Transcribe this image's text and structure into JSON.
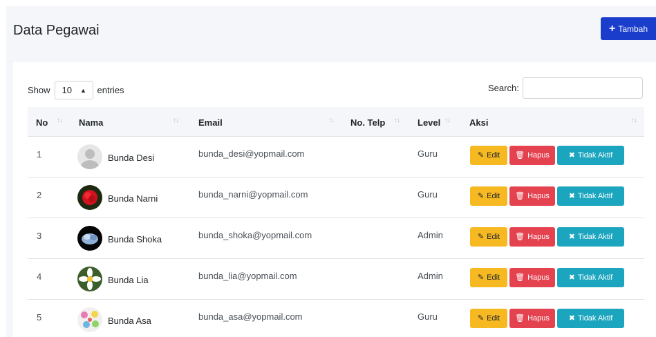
{
  "header": {
    "title": "Data Pegawai",
    "add_label": "Tambah"
  },
  "table_controls": {
    "show_label": "Show",
    "entries_value": "10",
    "entries_label": "entries",
    "search_label": "Search:"
  },
  "columns": [
    "No",
    "Nama",
    "Email",
    "No. Telp",
    "Level",
    "Aksi"
  ],
  "actions": {
    "edit": "Edit",
    "hapus": "Hapus",
    "nonaktif": "Tidak Aktif"
  },
  "rows": [
    {
      "no": "1",
      "nama": "Bunda Desi",
      "email": "bunda_desi@yopmail.com",
      "telp": "",
      "level": "Guru",
      "avatar": "placeholder-avatar-icon"
    },
    {
      "no": "2",
      "nama": "Bunda Narni",
      "email": "bunda_narni@yopmail.com",
      "telp": "",
      "level": "Guru",
      "avatar": "red-flower-photo"
    },
    {
      "no": "3",
      "nama": "Bunda Shoka",
      "email": "bunda_shoka@yopmail.com",
      "telp": "",
      "level": "Admin",
      "avatar": "blue-flower-photo"
    },
    {
      "no": "4",
      "nama": "Bunda Lia",
      "email": "bunda_lia@yopmail.com",
      "telp": "",
      "level": "Admin",
      "avatar": "white-flower-photo"
    },
    {
      "no": "5",
      "nama": "Bunda Asa",
      "email": "bunda_asa@yopmail.com",
      "telp": "",
      "level": "Guru",
      "avatar": "colorful-flowers-photo"
    }
  ],
  "colors": {
    "primary": "#1a3dcc",
    "warning": "#f6b921",
    "danger": "#e4424f",
    "info": "#1ba5be",
    "page_bg": "#f4f6f9"
  }
}
